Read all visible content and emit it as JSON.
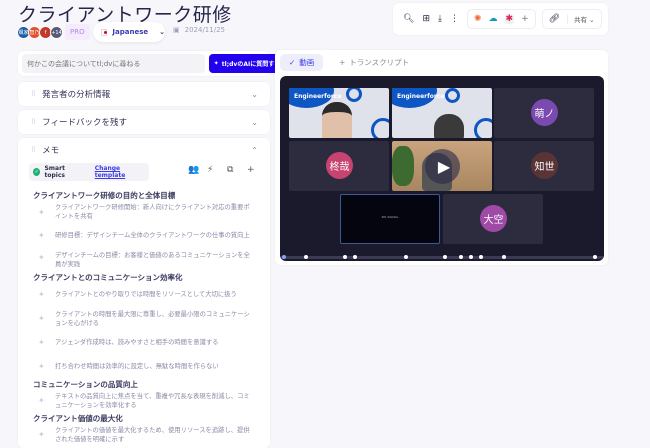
{
  "title": "クライアントワーク研修",
  "participants": [
    {
      "label": "颯家",
      "color": "#1c5fa8"
    },
    {
      "label": "智乃",
      "color": "#e0502a"
    },
    {
      "label": "f",
      "color": "#c0392b"
    },
    {
      "label": "+14",
      "color": "#5a5a78"
    }
  ],
  "plan_badge": "PRO",
  "language": "Japanese",
  "date": "2024/11/25",
  "ask": {
    "placeholder": "何かこの会議についてtl;dvに尋ねる",
    "button": "tl;dvのAIに質問する"
  },
  "sections": [
    {
      "label": "発言者の分析情報"
    },
    {
      "label": "フィードバックを残す"
    },
    {
      "label": "メモ"
    }
  ],
  "memo": {
    "smart_topics": "Smart topics",
    "change_template": "Change template",
    "topics": [
      {
        "heading": "クライアントワーク研修の目的と全体目標",
        "items": [
          "クライアントワーク研修開始：新人向けにクライアント対応の重要ポイントを共有",
          "研修目標：デザインチーム全体のクライアントワークの仕事の質向上",
          "デザインチームの目標：お客様と価値のあるコミュニケーションを全員が実践"
        ]
      },
      {
        "heading": "クライアントとのコミュニケーション効率化",
        "items": [
          "クライアントとのやり取りでは時間をリソースとして大切に扱う",
          "クライアントの時間を最大限に尊重し、必要最小限のコミュニケーションを心がける",
          "アジェンダ作成時は、読みやすさと相手の時間を意識する",
          "打ち合わせ時間は効率的に設定し、無駄な時間を作らない"
        ]
      },
      {
        "heading": "コミュニケーションの品質向上",
        "items": [
          "テキストの品質向上に焦点を当て、重複や冗長な表現を削減し、コミュニケーションを効率化する"
        ]
      },
      {
        "heading": "クライアント価値の最大化",
        "items": [
          "クライアントの価値を最大化するため、使用リソースを追跡し、提供された価値を明確に示す"
        ]
      }
    ]
  },
  "toolbar": {
    "share": "共有"
  },
  "video_panel": {
    "tab_video": "動画",
    "tab_transcript": "トランスクリプト",
    "slide_brand": "Engineerforce",
    "participants": [
      "萌ノ",
      "柊哉",
      "知世",
      "大空"
    ],
    "no_signal": "NO SIGNAL",
    "colors": {
      "萌ノ": "#7a4ab0",
      "柊哉": "#c84470",
      "知世": "#5a3434",
      "大空": "#a04aa8"
    }
  }
}
